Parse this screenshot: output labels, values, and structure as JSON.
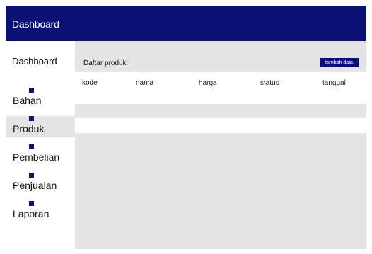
{
  "header": {
    "title": "Dashboard"
  },
  "sidebar": {
    "heading": "Dashboard",
    "items": [
      {
        "label": "Bahan",
        "icon": "square-icon"
      },
      {
        "label": "Produk",
        "icon": "square-icon",
        "active": true
      },
      {
        "label": "Pembelian",
        "icon": "square-icon"
      },
      {
        "label": "Penjualan",
        "icon": "square-icon"
      },
      {
        "label": "Laporan",
        "icon": "square-icon"
      }
    ]
  },
  "main": {
    "title": "Daftar produk",
    "add_button_label": "tambah data",
    "table": {
      "columns": [
        "kode",
        "nama",
        "harga",
        "status",
        "tanggal"
      ],
      "rows": [
        [
          "",
          "",
          "",
          "",
          ""
        ]
      ]
    }
  },
  "colors": {
    "header_bg": "#0a1172",
    "content_bg": "#e4e4e4",
    "accent": "#0a1172"
  }
}
